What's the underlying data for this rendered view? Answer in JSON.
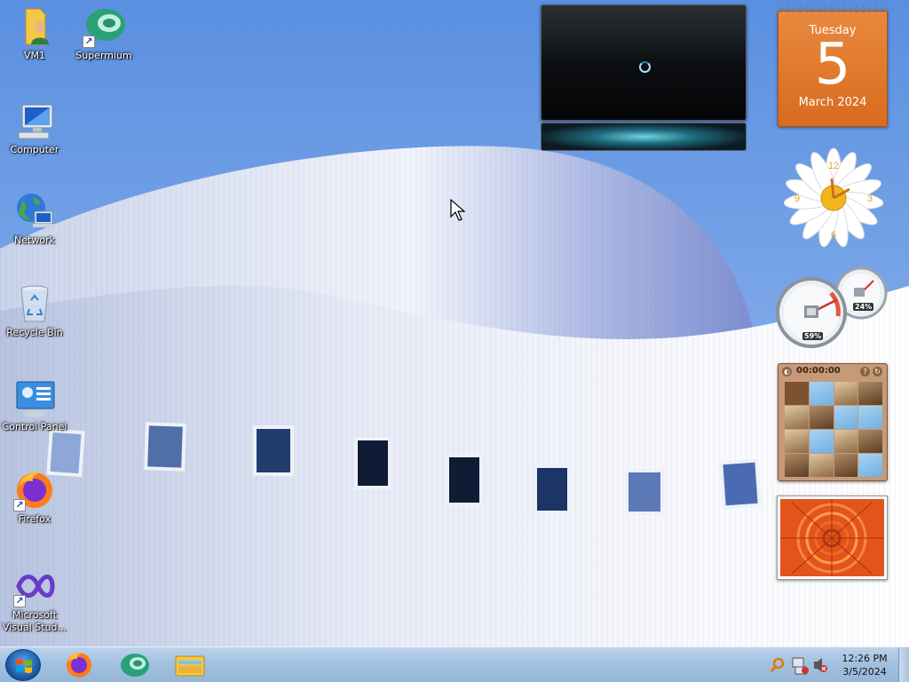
{
  "desktop": {
    "icons": [
      {
        "label": "VM1",
        "icon": "user-folder-icon"
      },
      {
        "label": "Supermium",
        "icon": "supermium-browser-icon"
      },
      {
        "label": "Computer",
        "icon": "computer-icon"
      },
      {
        "label": "Network",
        "icon": "network-icon"
      },
      {
        "label": "Recycle Bin",
        "icon": "recycle-bin-icon"
      },
      {
        "label": "Control Panel",
        "icon": "control-panel-icon"
      },
      {
        "label": "Firefox",
        "icon": "firefox-icon"
      },
      {
        "label": "Microsoft Visual Stud...",
        "icon": "visual-studio-icon"
      }
    ]
  },
  "gadgets": {
    "calendar": {
      "day_name": "Tuesday",
      "day_number": "5",
      "month_year": "March 2024"
    },
    "clock": {
      "numerals": [
        "12",
        "3",
        "6",
        "9"
      ]
    },
    "cpu_meter": {
      "cpu": "59%",
      "memory": "24%"
    },
    "puzzle": {
      "timer": "00:00:00"
    }
  },
  "taskbar": {
    "pinned": [
      {
        "name": "Firefox",
        "icon": "firefox-icon"
      },
      {
        "name": "Supermium",
        "icon": "supermium-browser-icon"
      },
      {
        "name": "Windows Explorer",
        "icon": "explorer-folder-icon"
      }
    ],
    "tray": {
      "time": "12:26 PM",
      "date": "3/5/2024",
      "icons": [
        "search-icon",
        "network-status-icon",
        "volume-muted-icon"
      ]
    }
  },
  "colors": {
    "sky": "#6f9fe6",
    "calendar_orange": "#d86b1f",
    "taskbar": "#a3c1df"
  }
}
